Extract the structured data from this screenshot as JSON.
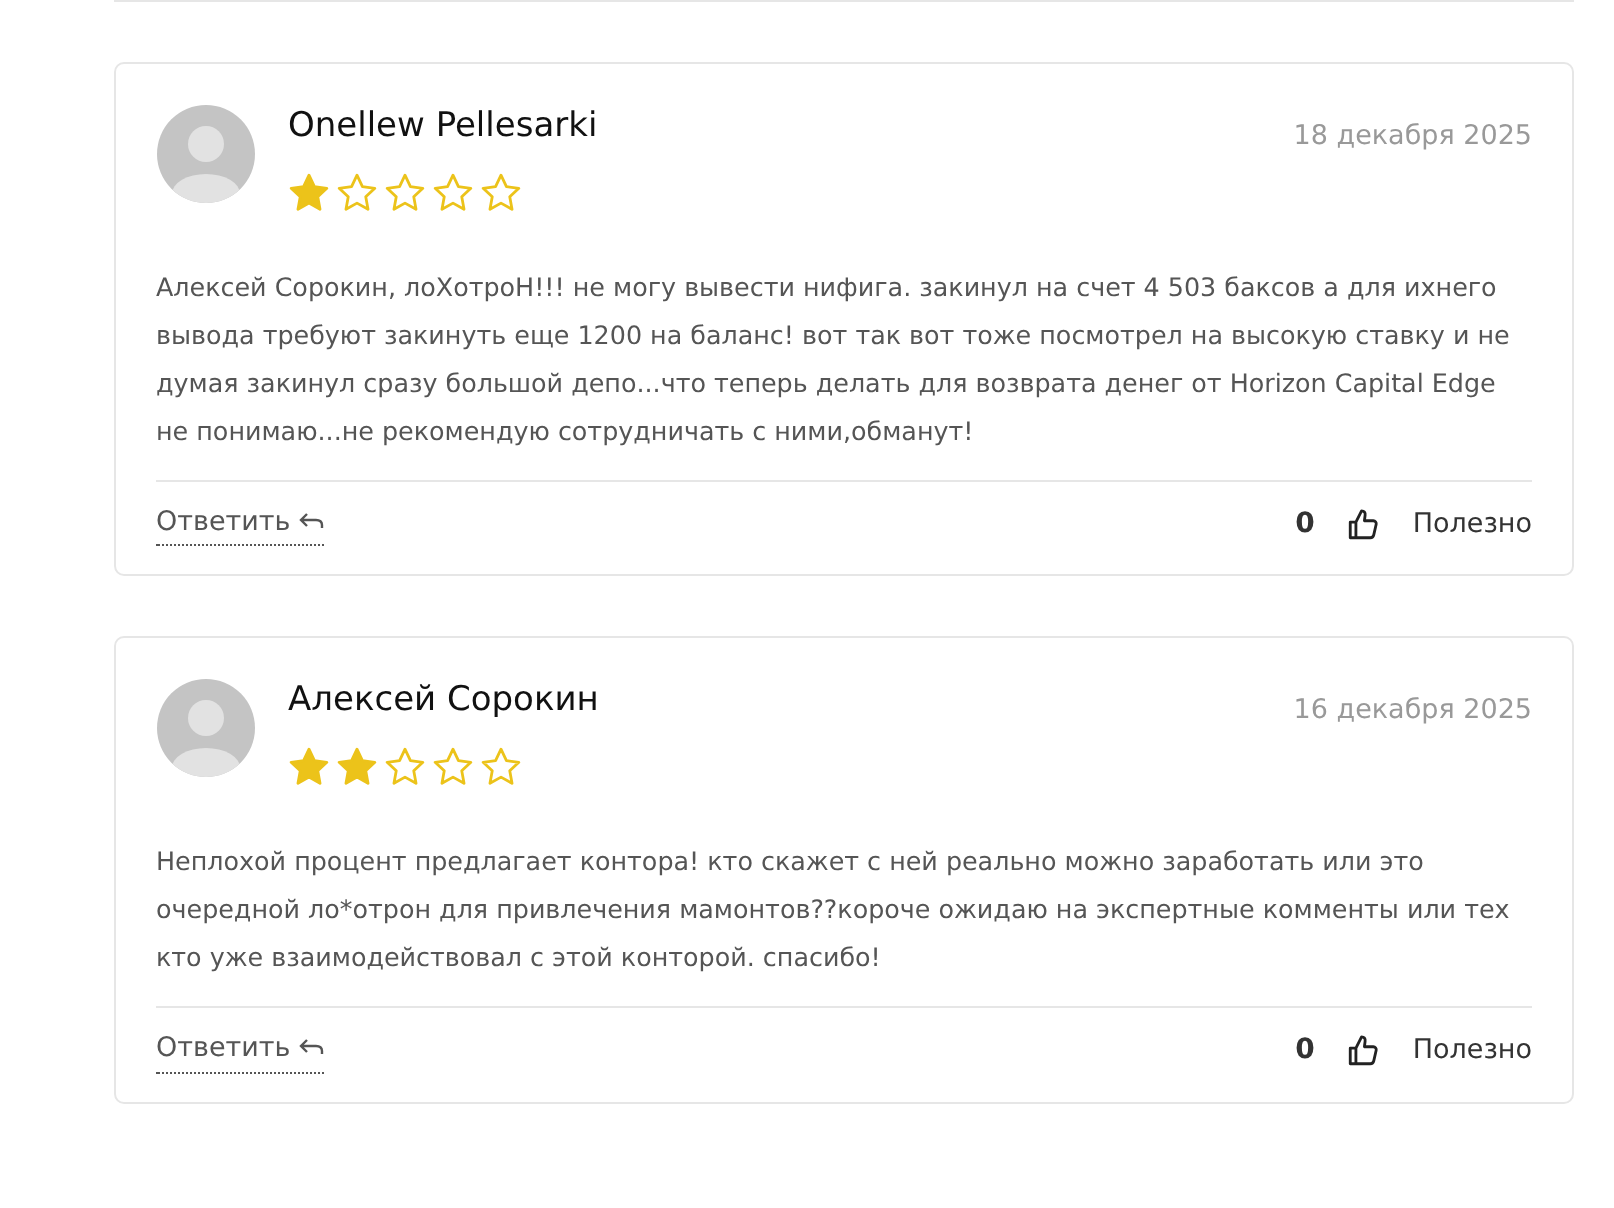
{
  "reviews": [
    {
      "author": "Onellew Pellesarki",
      "date": "18 декабря 2025",
      "stars": 1,
      "text": "Алексей Сорокин, лоХотроН!!! не могу вывести нифига. закинул на счет 4 503 баксов а для ихнего вывода требуют закинуть еще 1200 на баланс! вот так вот тоже посмотрел на высокую ставку и не думая закинул сразу большой депо...что теперь делать для возврата денег от Horizon Capital Edge не понимаю...не рекомендую сотрудничать с ними,обманут!",
      "reply": "Ответить",
      "likes": "0",
      "helpful": "Полезно"
    },
    {
      "author": "Алексей Сорокин",
      "date": "16 декабря 2025",
      "stars": 2,
      "text": "Неплохой процент предлагает контора! кто скажет с ней реально можно заработать или это очередной ло*отрон для привлечения мамонтов??короче ожидаю на экспертные комменты или тех кто уже взаимодействовал с этой конторой. спасибо!",
      "reply": "Ответить",
      "likes": "0",
      "helpful": "Полезно"
    }
  ]
}
